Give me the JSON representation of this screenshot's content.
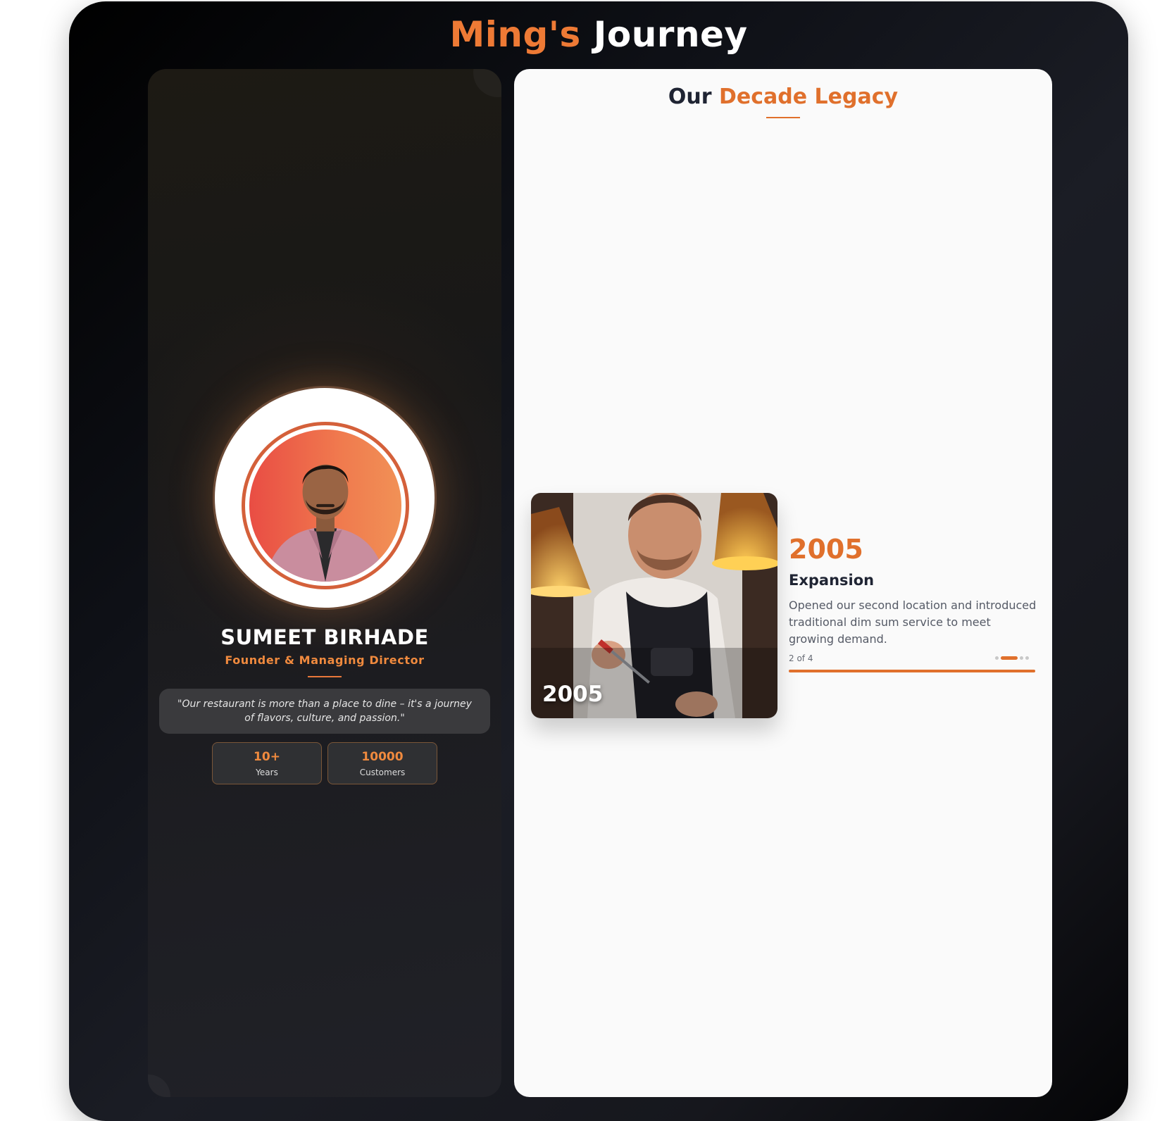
{
  "header": {
    "title_accent": "Ming's",
    "title_rest": "Journey"
  },
  "profile": {
    "name": "SUMEET BIRHADE",
    "role": "Founder & Managing Director",
    "quote": "\"Our restaurant is more than a place to dine – it's a journey of flavors, culture, and passion.\"",
    "stats": [
      {
        "value": "10+",
        "label": "Years"
      },
      {
        "value": "10000",
        "label": "Customers"
      }
    ]
  },
  "legacy": {
    "title_dark": "Our",
    "title_orange": "Decade Legacy",
    "current_event": {
      "photo_year": "2005",
      "year": "2005",
      "title": "Expansion",
      "description": "Opened our second location and introduced traditional dim sum service to meet growing demand."
    },
    "slide_counter": "2 of 4",
    "slide_index": 2,
    "slide_total": 4,
    "progress_fraction": 1.0
  },
  "colors": {
    "accent": "#e0702c",
    "dark_text": "#1f2433"
  }
}
